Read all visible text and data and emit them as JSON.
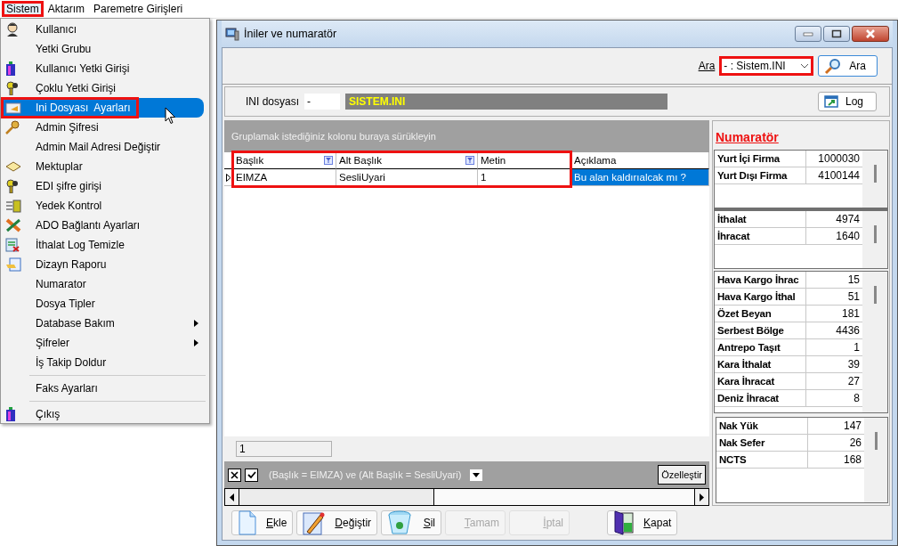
{
  "menubar": [
    {
      "label": "Sistem",
      "selected": true,
      "annotated": true
    },
    {
      "label": "Aktarım",
      "selected": false,
      "annotated": false
    },
    {
      "label": "Paremetre Girişleri",
      "selected": false,
      "annotated": false
    }
  ],
  "menu": {
    "groups": [
      [
        {
          "label": "Kullanıcı",
          "selected": false,
          "submenu": false,
          "annotated": false
        },
        {
          "label": "Yetki Grubu",
          "selected": false,
          "submenu": false,
          "annotated": false
        },
        {
          "label": "Kullanıcı Yetki Girişi",
          "selected": false,
          "submenu": false,
          "annotated": false
        },
        {
          "label": "Çoklu Yetki Girişi",
          "selected": false,
          "submenu": false,
          "annotated": false
        },
        {
          "label": "Ini Dosyası  Ayarları",
          "selected": true,
          "submenu": false,
          "annotated": true
        },
        {
          "label": "Admin Şifresi",
          "selected": false,
          "submenu": false,
          "annotated": false
        },
        {
          "label": "Admin Mail Adresi Değiştir",
          "selected": false,
          "submenu": false,
          "annotated": false
        },
        {
          "label": "Mektuplar",
          "selected": false,
          "submenu": false,
          "annotated": false
        },
        {
          "label": "EDI şifre girişi",
          "selected": false,
          "submenu": false,
          "annotated": false
        },
        {
          "label": "Yedek Kontrol",
          "selected": false,
          "submenu": false,
          "annotated": false
        },
        {
          "label": "ADO Bağlantı Ayarları",
          "selected": false,
          "submenu": false,
          "annotated": false
        },
        {
          "label": "İthalat Log Temizle",
          "selected": false,
          "submenu": false,
          "annotated": false
        },
        {
          "label": "Dizayn Raporu",
          "selected": false,
          "submenu": false,
          "annotated": false
        },
        {
          "label": "Numarator",
          "selected": false,
          "submenu": false,
          "annotated": false
        },
        {
          "label": "Dosya Tipler",
          "selected": false,
          "submenu": false,
          "annotated": false
        },
        {
          "label": "Database Bakım",
          "selected": false,
          "submenu": true,
          "annotated": false
        },
        {
          "label": "Şifreler",
          "selected": false,
          "submenu": true,
          "annotated": false
        },
        {
          "label": "İş Takip Doldur",
          "selected": false,
          "submenu": false,
          "annotated": false
        }
      ],
      [
        {
          "label": "Faks Ayarları",
          "selected": false,
          "submenu": false,
          "annotated": false
        }
      ],
      [
        {
          "label": "Çıkış",
          "selected": false,
          "submenu": false,
          "annotated": false
        }
      ]
    ]
  },
  "window": {
    "title": "İniler ve numaratör",
    "search": {
      "label": "Ara",
      "value": "- : Sistem.INI",
      "annotated": true,
      "button": "Ara"
    },
    "ini": {
      "label": "INI dosyası",
      "code": "-",
      "name": "SISTEM.INI",
      "log_button": "Log"
    },
    "grid": {
      "group_hint": "Gruplamak istediğiniz kolonu buraya sürükleyin",
      "columns": [
        {
          "title": "Başlık",
          "filter": true,
          "annotated": true
        },
        {
          "title": "Alt Başlık",
          "filter": true,
          "annotated": true
        },
        {
          "title": "Metin",
          "filter": false,
          "annotated": true
        },
        {
          "title": "Açıklama",
          "filter": false,
          "annotated": false
        }
      ],
      "rows": [
        {
          "current": true,
          "cells": [
            {
              "text": "EIMZA",
              "selected": false
            },
            {
              "text": "SesliUyari",
              "selected": false
            },
            {
              "text": "1",
              "selected": false
            },
            {
              "text": "Bu alan kaldırıalcak mı ?",
              "selected": true
            }
          ]
        }
      ],
      "footer_value": "1",
      "filter": {
        "enabled": true,
        "text": "(Başlık = EIMZA) ve (Alt Başlık = SesliUyari)",
        "customize_button": "Özelleştir"
      }
    },
    "numerator": {
      "title": "Numaratör",
      "groups": [
        {
          "rows": [
            {
              "name": "Yurt İçi Firma",
              "value": "1000030"
            },
            {
              "name": "Yurt Dışı Firma",
              "value": "4100144"
            }
          ]
        },
        {
          "rows": [
            {
              "name": "İthalat",
              "value": "4974"
            },
            {
              "name": "İhracat",
              "value": "1640"
            }
          ]
        },
        {
          "rows": [
            {
              "name": "Hava Kargo İhrac",
              "value": "15"
            },
            {
              "name": "Hava Kargo İthal",
              "value": "51"
            },
            {
              "name": "Özet Beyan",
              "value": "181"
            },
            {
              "name": "Serbest Bölge",
              "value": "4436"
            },
            {
              "name": "Antrepo Taşıt",
              "value": "1"
            },
            {
              "name": "Kara İthalat",
              "value": "39"
            },
            {
              "name": "Kara İhracat",
              "value": "27"
            },
            {
              "name": "Deniz İhracat",
              "value": "8"
            }
          ]
        },
        {
          "rows": [
            {
              "name": "Nak Yük",
              "value": "147"
            },
            {
              "name": "Nak Sefer",
              "value": "26"
            },
            {
              "name": "NCTS",
              "value": "168"
            }
          ]
        }
      ]
    },
    "buttons": [
      {
        "label": "Ekle",
        "disabled": false
      },
      {
        "label": "Değiştir",
        "disabled": false
      },
      {
        "label": "Sil",
        "disabled": false
      },
      {
        "label": "Tamam",
        "disabled": true
      },
      {
        "label": "İptal",
        "disabled": true
      },
      {
        "label": "Kapat",
        "disabled": false
      }
    ]
  }
}
